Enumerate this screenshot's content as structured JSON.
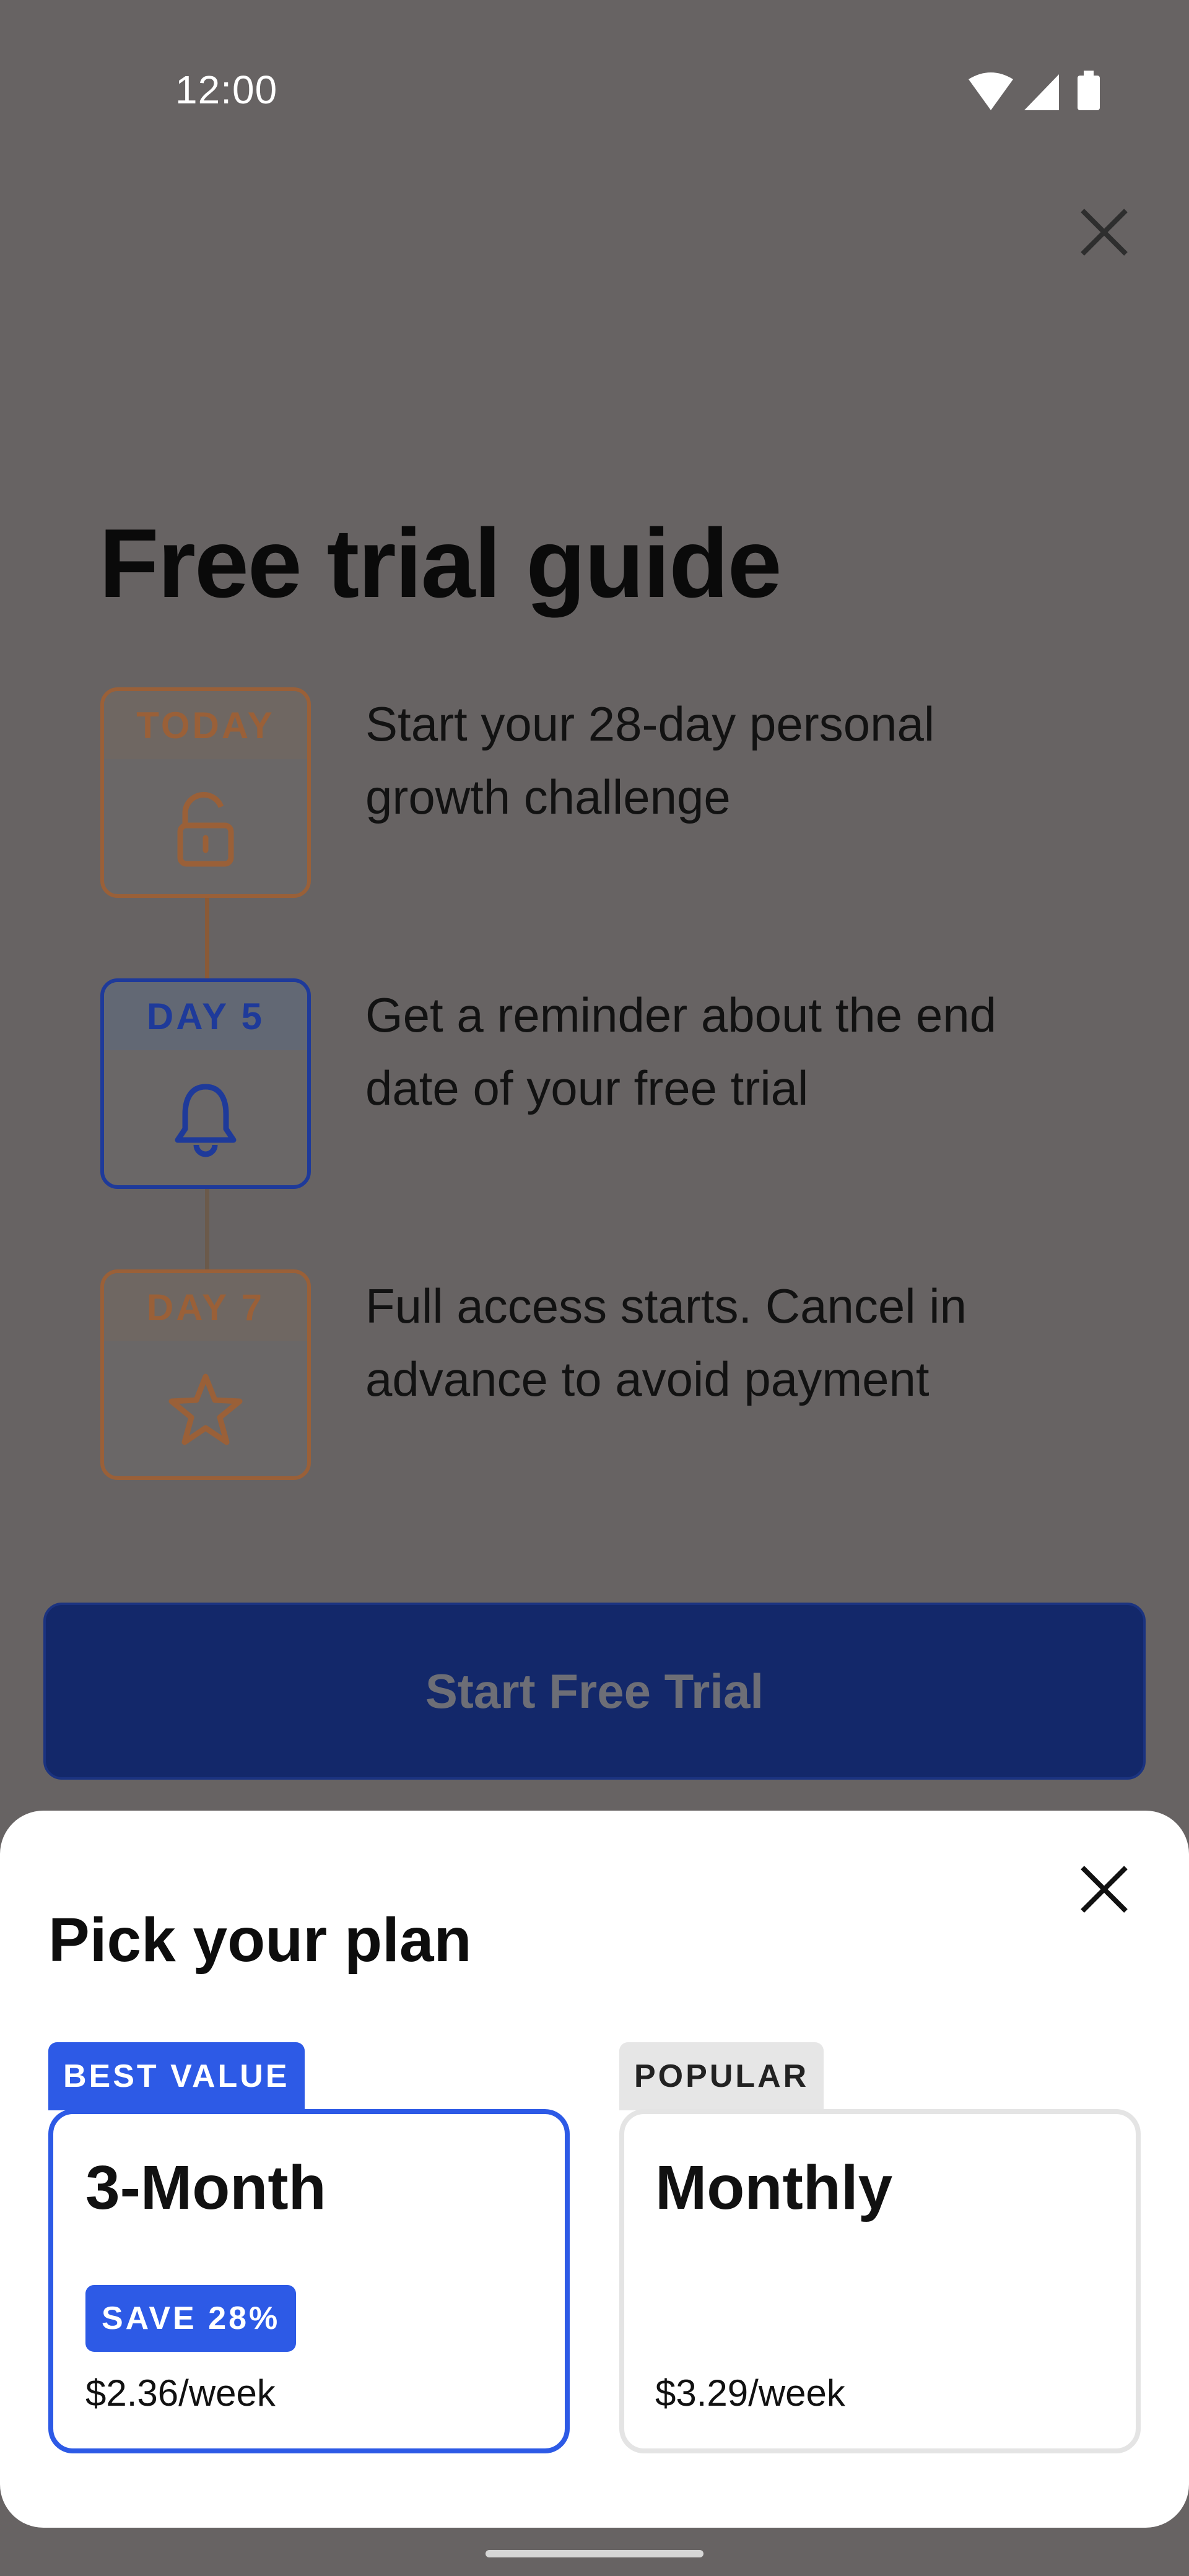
{
  "status_bar": {
    "time": "12:00"
  },
  "title": "Free trial guide",
  "steps": [
    {
      "label": "TODAY",
      "icon": "unlock-icon",
      "text_line1": "Start your 28-day personal",
      "text_line2": "growth challenge"
    },
    {
      "label": "DAY 5",
      "icon": "bell-icon",
      "text_line1": "Get a reminder about the end",
      "text_line2": "date of your free trial"
    },
    {
      "label": "DAY 7",
      "icon": "star-icon",
      "text_line1": "Full access starts. Cancel in",
      "text_line2": "advance to avoid payment"
    }
  ],
  "cta": {
    "label": "Start Free Trial"
  },
  "sheet": {
    "title": "Pick your plan",
    "plans": [
      {
        "tag": "BEST VALUE",
        "name": "3-Month",
        "badge": "SAVE 28%",
        "price": "$2.36/week",
        "selected": true
      },
      {
        "tag": "POPULAR",
        "name": "Monthly",
        "price": "$3.29/week",
        "selected": false
      }
    ]
  },
  "colors": {
    "accent": "#2d5ae6",
    "cta": "#13286a",
    "orange": "#9a6038",
    "overlay": "#676363"
  }
}
